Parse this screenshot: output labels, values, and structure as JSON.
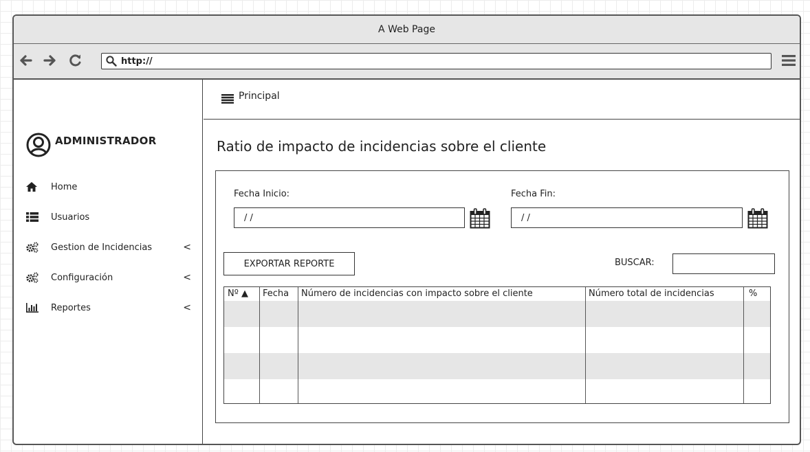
{
  "window": {
    "title": "A Web Page"
  },
  "browser": {
    "url": "http://"
  },
  "sidebar": {
    "user": "ADMINISTRADOR",
    "items": [
      {
        "label": "Home",
        "icon": "home-icon",
        "chevron": ""
      },
      {
        "label": "Usuarios",
        "icon": "list-icon",
        "chevron": ""
      },
      {
        "label": "Gestion de Incidencias",
        "icon": "gears-icon",
        "chevron": "<"
      },
      {
        "label": "Configuración",
        "icon": "gears-icon",
        "chevron": "<"
      },
      {
        "label": "Reportes",
        "icon": "bar-chart-icon",
        "chevron": "<"
      }
    ]
  },
  "main": {
    "header_label": "Principal",
    "title": "Ratio de impacto de incidencias sobre el cliente",
    "fecha_inicio_label": "Fecha Inicio:",
    "fecha_inicio_value": "/ /",
    "fecha_fin_label": "Fecha Fin:",
    "fecha_fin_value": "/ /",
    "export_label": "EXPORTAR REPORTE",
    "search_label": "BUSCAR:",
    "table": {
      "columns": [
        "Nº ▲",
        "Fecha",
        "Número de incidencias con impacto sobre el cliente",
        "Número total de incidencias",
        "%"
      ],
      "rows": []
    }
  }
}
